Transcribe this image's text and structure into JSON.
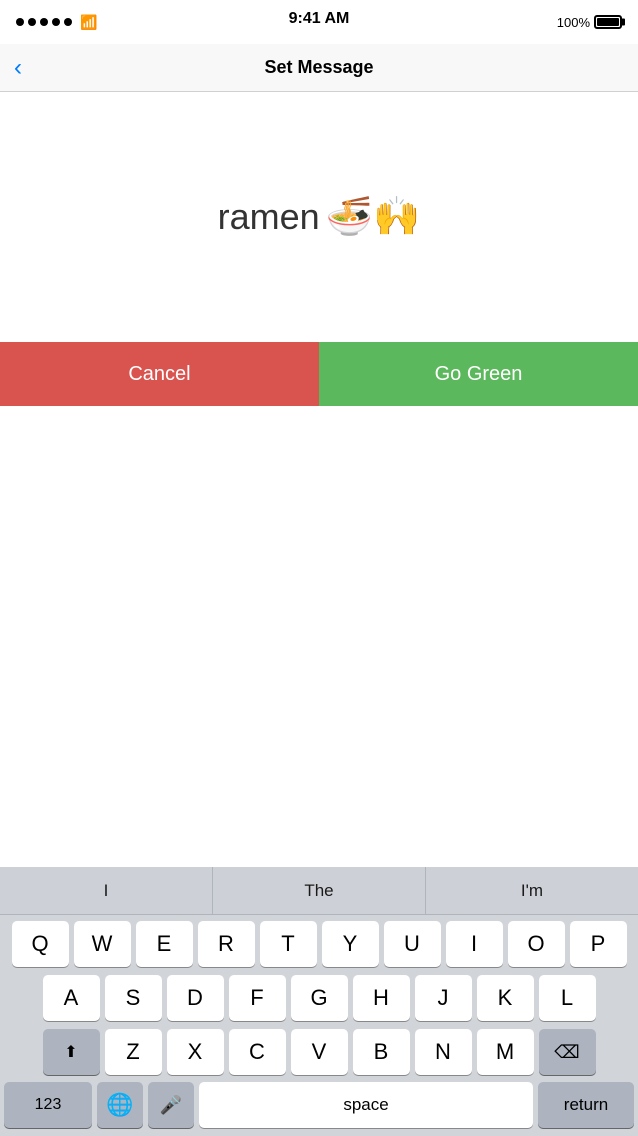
{
  "statusBar": {
    "time": "9:41 AM",
    "battery": "100%"
  },
  "navBar": {
    "title": "Set Message",
    "backLabel": "‹"
  },
  "message": {
    "text": "ramen",
    "emoji": "🍜🙌"
  },
  "actionButtons": {
    "cancel": "Cancel",
    "goGreen": "Go Green"
  },
  "autocomplete": {
    "items": [
      "I",
      "The",
      "I'm"
    ]
  },
  "keyboard": {
    "row1": [
      "Q",
      "W",
      "E",
      "R",
      "T",
      "Y",
      "U",
      "I",
      "O",
      "P"
    ],
    "row2": [
      "A",
      "S",
      "D",
      "F",
      "G",
      "H",
      "J",
      "K",
      "L"
    ],
    "row3": [
      "Z",
      "X",
      "C",
      "V",
      "B",
      "N",
      "M"
    ],
    "shiftLabel": "⬆",
    "deleteLabel": "⌫",
    "numbersLabel": "123",
    "globeLabel": "🌐",
    "micLabel": "🎤",
    "spaceLabel": "space",
    "returnLabel": "return"
  }
}
